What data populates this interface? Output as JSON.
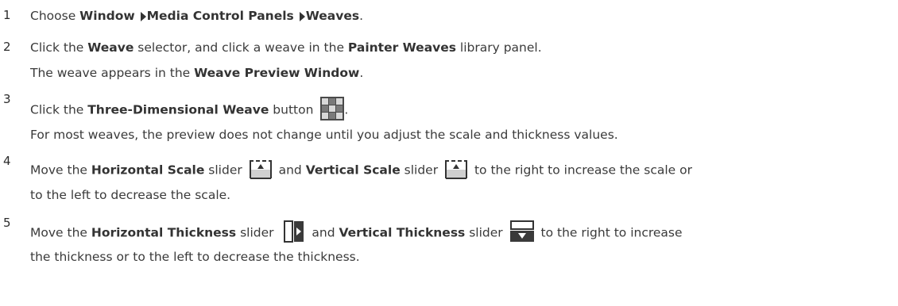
{
  "steps": [
    {
      "number": "1",
      "lines": [
        {
          "t1": "Choose ",
          "b1": "Window",
          "b2": "Media Control Panels",
          "b3": "Weaves",
          "t2": "."
        }
      ]
    },
    {
      "number": "2",
      "lines": [
        {
          "t1": "Click the ",
          "b1": "Weave",
          "t2": " selector, and click a weave in the ",
          "b2": "Painter Weaves",
          "t3": " library panel."
        },
        {
          "t1": "The weave appears in the ",
          "b1": "Weave Preview Window",
          "t2": "."
        }
      ]
    },
    {
      "number": "3",
      "lines": [
        {
          "t1": "Click the ",
          "b1": "Three-Dimensional Weave",
          "t2": " button",
          "t3": "."
        },
        {
          "t1": "For most weaves, the preview does not change until you adjust the scale and thickness values."
        }
      ]
    },
    {
      "number": "4",
      "lines": [
        {
          "t1": "Move the ",
          "b1": "Horizontal Scale",
          "t2": " slider",
          "t3": " and ",
          "b2": "Vertical Scale",
          "t4": " slider",
          "t5": " to the right to increase the scale or"
        },
        {
          "t1": "to the left to decrease the scale."
        }
      ]
    },
    {
      "number": "5",
      "lines": [
        {
          "t1": "Move the ",
          "b1": "Horizontal Thickness",
          "t2": " slider",
          "t3": " and ",
          "b2": "Vertical Thickness",
          "t4": " slider",
          "t5": " to the right to increase"
        },
        {
          "t1": "the thickness or to the left to decrease the thickness."
        }
      ]
    }
  ],
  "icons": {
    "menu_arrow": "triangle-right-icon",
    "three_d_weave": "three-dimensional-weave-icon",
    "horizontal_scale": "horizontal-scale-slider-icon",
    "vertical_scale": "vertical-scale-slider-icon",
    "horizontal_thickness": "horizontal-thickness-slider-icon",
    "vertical_thickness": "vertical-thickness-slider-icon"
  }
}
